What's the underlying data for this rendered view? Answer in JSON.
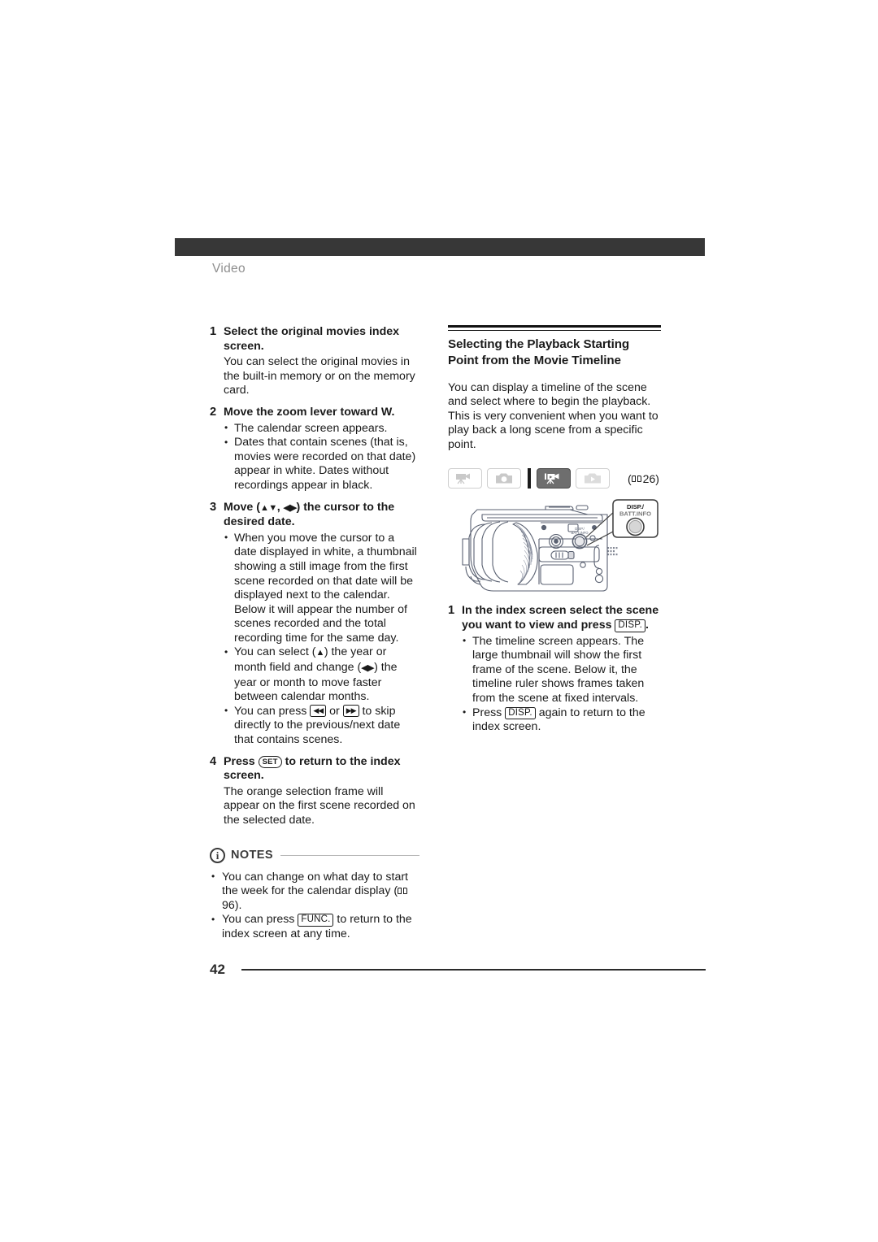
{
  "header": {
    "section_label": "Video"
  },
  "left_column": {
    "steps": [
      {
        "num": "1",
        "title": "Select the original movies index screen.",
        "body": "You can select the original movies in the built-in memory or on the memory card."
      },
      {
        "num": "2",
        "title": "Move the zoom lever toward W.",
        "bullets": [
          "The calendar screen appears.",
          "Dates that contain scenes (that is, movies were recorded on that date) appear in white. Dates without recordings appear in black."
        ]
      },
      {
        "num": "3",
        "title_pre": "Move (",
        "title_btn1": "▲▼",
        "title_mid": ", ",
        "title_btn2": "◀▶",
        "title_post": ") the cursor to the desired date.",
        "bullets": [
          "When you move the cursor to a date displayed in white, a thumbnail showing a still image from the first scene recorded on that date will be displayed next to the calendar. Below it will appear the number of scenes recorded and the total recording time for the same day."
        ],
        "bullet2_pre": "You can select (",
        "bullet2_a": "▲",
        "bullet2_mid": ") the year or month field and change (",
        "bullet2_b": "◀▶",
        "bullet2_post": ") the year or month to move faster between calendar months.",
        "bullet3_pre": "You can press ",
        "bullet3_a": "◀◀",
        "bullet3_mid": " or ",
        "bullet3_b": "▶▶",
        "bullet3_post": " to skip directly to the previous/next date that contains scenes."
      },
      {
        "num": "4",
        "title_pre": "Press ",
        "title_btn": "SET",
        "title_post": " to return to the index screen.",
        "body": "The orange selection frame will appear on the first scene recorded on the selected date."
      }
    ],
    "notes": {
      "icon": "info-circle-icon",
      "title": "NOTES",
      "bullets": [
        {
          "pre": "You can change on what day to start the week for the calendar display (",
          "page_ref": "96",
          "post": ")."
        },
        {
          "pre": "You can press ",
          "btn": "FUNC.",
          "post": " to return to the index screen at any time."
        }
      ]
    }
  },
  "right_column": {
    "heading": "Selecting the Playback Starting Point from the Movie Timeline",
    "intro": "You can display a timeline of the scene and select where to begin the playback. This is very convenient when you want to play back a long scene from a specific point.",
    "mode_row": {
      "chips": [
        {
          "icon": "camcorder-record-icon",
          "active": false
        },
        {
          "icon": "photo-camera-record-icon",
          "active": false
        },
        {
          "icon": "camcorder-playback-icon",
          "active": true
        },
        {
          "icon": "photo-playback-icon",
          "active": false
        }
      ],
      "page_ref_open": "(",
      "page_ref": "26",
      "page_ref_close": ")"
    },
    "figure": {
      "name": "camcorder-side-view-illustration",
      "callout_line1": "DISP./",
      "callout_line2": "BATT.INFO",
      "body_label_line1": "DISP./",
      "body_label_line2": "BATT.INFO"
    },
    "steps": [
      {
        "num": "1",
        "title_pre": "In the index screen select the scene you want to view and press ",
        "title_btn": "DISP.",
        "title_post": ".",
        "bullets": [
          "The timeline screen appears. The large thumbnail will show the first frame of the scene. Below it, the timeline ruler shows frames taken from the scene at fixed intervals."
        ],
        "bullet2_pre": "Press ",
        "bullet2_btn": "DISP.",
        "bullet2_post": " again to return to the index screen."
      }
    ]
  },
  "footer": {
    "page_number": "42"
  },
  "colors": {
    "header_bar": "#373737",
    "section_label": "#8e8e8e",
    "line_art": "#5b6272",
    "text": "#1a1a1a",
    "active_chip": "#6e6e6e"
  }
}
